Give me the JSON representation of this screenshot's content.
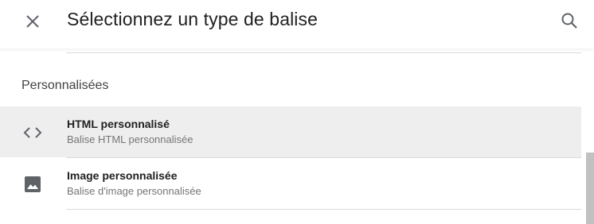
{
  "header": {
    "title": "Sélectionnez un type de balise",
    "close_icon": "close-icon",
    "search_icon": "search-icon"
  },
  "section": {
    "title": "Personnalisées"
  },
  "tags": [
    {
      "name": "HTML personnalisé",
      "description": "Balise HTML personnalisée",
      "icon": "code-icon",
      "highlighted": true
    },
    {
      "name": "Image personnalisée",
      "description": "Balise d'image personnalisée",
      "icon": "image-icon",
      "highlighted": false
    }
  ],
  "colors": {
    "text_primary": "#212121",
    "text_secondary": "#757575",
    "icon": "#5f6368",
    "highlight_bg": "#eeeeee",
    "divider": "#dadada"
  }
}
